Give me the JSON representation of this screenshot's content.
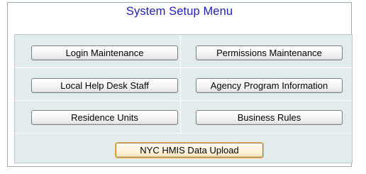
{
  "menu": {
    "title": "System Setup Menu",
    "buttons": {
      "login_maintenance": "Login Maintenance",
      "permissions_maintenance": "Permissions Maintenance",
      "local_help_desk_staff": "Local Help Desk Staff",
      "agency_program_information": "Agency Program Information",
      "residence_units": "Residence Units",
      "business_rules": "Business Rules",
      "nyc_hmis_data_upload": "NYC HMIS Data Upload"
    }
  }
}
